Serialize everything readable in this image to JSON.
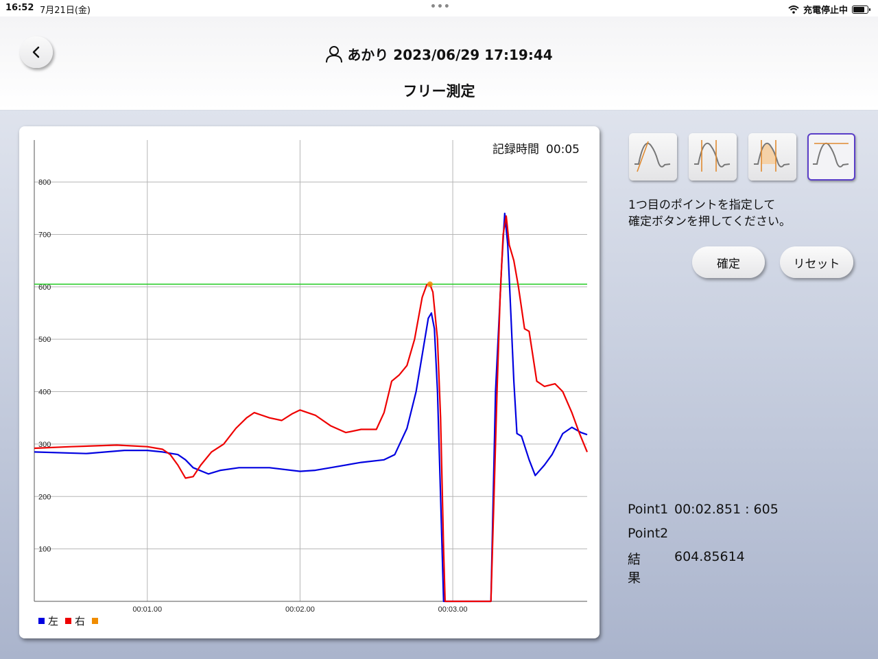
{
  "status_bar": {
    "time": "16:52",
    "date": "7月21日(金)",
    "charging": "充電停止中"
  },
  "header": {
    "user_name": "あかり",
    "timestamp": "2023/06/29 17:19:44",
    "title": "フリー測定"
  },
  "chart_panel": {
    "record_label": "記録時間",
    "record_time": "00:05"
  },
  "mode_buttons": [
    {
      "icon": "rising-slope-wave-icon",
      "selected": false
    },
    {
      "icon": "interval-wave-icon",
      "selected": false
    },
    {
      "icon": "area-wave-icon",
      "selected": false
    },
    {
      "icon": "peak-threshold-wave-icon",
      "selected": true
    }
  ],
  "instruction": {
    "line1": "1つ目のポイントを指定して",
    "line2": "確定ボタンを押してください。"
  },
  "buttons": {
    "confirm": "確定",
    "reset": "リセット"
  },
  "results": {
    "point1_label": "Point1",
    "point1_value": "00:02.851 : 605",
    "point2_label": "Point2",
    "point2_value": "",
    "result_label": "結果",
    "result_value": "604.85614"
  },
  "colors": {
    "left": "#0000e0",
    "right": "#ee0000",
    "marker": "#f08c00",
    "threshold": "#22cc22",
    "selected_border": "#5a3ec8"
  },
  "chart_data": {
    "type": "line",
    "x_tick_labels": [
      "00:01.00",
      "00:02.00",
      "00:03.00"
    ],
    "x_ticks": [
      1.0,
      2.0,
      3.0
    ],
    "xlim": [
      0.26,
      3.88
    ],
    "y_tick_labels": [
      "100",
      "200",
      "300",
      "400",
      "500",
      "600",
      "700",
      "800"
    ],
    "ylim": [
      0,
      880
    ],
    "threshold": 605,
    "marker": {
      "x": 2.851,
      "y": 605
    },
    "legend": [
      {
        "label": "左",
        "color": "#0000e0"
      },
      {
        "label": "右",
        "color": "#ee0000"
      },
      {
        "label": "",
        "color": "#f08c00"
      }
    ],
    "series": [
      {
        "name": "左",
        "color": "#0000e0",
        "points": [
          [
            0.26,
            285
          ],
          [
            0.6,
            282
          ],
          [
            0.85,
            288
          ],
          [
            1.0,
            288
          ],
          [
            1.1,
            285
          ],
          [
            1.2,
            280
          ],
          [
            1.25,
            270
          ],
          [
            1.3,
            255
          ],
          [
            1.4,
            243
          ],
          [
            1.48,
            250
          ],
          [
            1.6,
            255
          ],
          [
            1.8,
            255
          ],
          [
            2.0,
            248
          ],
          [
            2.1,
            250
          ],
          [
            2.2,
            255
          ],
          [
            2.4,
            265
          ],
          [
            2.55,
            270
          ],
          [
            2.62,
            280
          ],
          [
            2.7,
            330
          ],
          [
            2.76,
            400
          ],
          [
            2.8,
            470
          ],
          [
            2.84,
            540
          ],
          [
            2.86,
            550
          ],
          [
            2.88,
            520
          ],
          [
            2.9,
            400
          ],
          [
            2.92,
            200
          ],
          [
            2.94,
            0
          ],
          [
            3.0,
            0
          ],
          [
            3.1,
            0
          ],
          [
            3.2,
            0
          ],
          [
            3.25,
            0
          ],
          [
            3.28,
            400
          ],
          [
            3.3,
            520
          ],
          [
            3.32,
            640
          ],
          [
            3.34,
            740
          ],
          [
            3.36,
            680
          ],
          [
            3.38,
            550
          ],
          [
            3.4,
            420
          ],
          [
            3.42,
            320
          ],
          [
            3.45,
            315
          ],
          [
            3.5,
            270
          ],
          [
            3.54,
            240
          ],
          [
            3.6,
            260
          ],
          [
            3.65,
            280
          ],
          [
            3.72,
            320
          ],
          [
            3.78,
            332
          ],
          [
            3.84,
            322
          ],
          [
            3.88,
            318
          ]
        ]
      },
      {
        "name": "右",
        "color": "#ee0000",
        "points": [
          [
            0.26,
            292
          ],
          [
            0.5,
            295
          ],
          [
            0.8,
            298
          ],
          [
            1.0,
            295
          ],
          [
            1.1,
            290
          ],
          [
            1.15,
            280
          ],
          [
            1.2,
            260
          ],
          [
            1.25,
            235
          ],
          [
            1.3,
            238
          ],
          [
            1.35,
            260
          ],
          [
            1.42,
            285
          ],
          [
            1.5,
            300
          ],
          [
            1.58,
            330
          ],
          [
            1.65,
            350
          ],
          [
            1.7,
            360
          ],
          [
            1.8,
            350
          ],
          [
            1.88,
            345
          ],
          [
            1.95,
            358
          ],
          [
            2.0,
            365
          ],
          [
            2.1,
            355
          ],
          [
            2.2,
            335
          ],
          [
            2.3,
            322
          ],
          [
            2.4,
            328
          ],
          [
            2.5,
            328
          ],
          [
            2.55,
            360
          ],
          [
            2.6,
            420
          ],
          [
            2.65,
            432
          ],
          [
            2.7,
            450
          ],
          [
            2.75,
            500
          ],
          [
            2.8,
            580
          ],
          [
            2.83,
            604
          ],
          [
            2.85,
            605
          ],
          [
            2.87,
            590
          ],
          [
            2.9,
            500
          ],
          [
            2.92,
            350
          ],
          [
            2.94,
            100
          ],
          [
            2.95,
            0
          ],
          [
            3.0,
            0
          ],
          [
            3.1,
            0
          ],
          [
            3.2,
            0
          ],
          [
            3.25,
            0
          ],
          [
            3.27,
            200
          ],
          [
            3.29,
            400
          ],
          [
            3.31,
            580
          ],
          [
            3.33,
            700
          ],
          [
            3.35,
            735
          ],
          [
            3.37,
            680
          ],
          [
            3.4,
            650
          ],
          [
            3.43,
            600
          ],
          [
            3.47,
            520
          ],
          [
            3.5,
            515
          ],
          [
            3.55,
            420
          ],
          [
            3.6,
            410
          ],
          [
            3.67,
            415
          ],
          [
            3.72,
            400
          ],
          [
            3.78,
            360
          ],
          [
            3.83,
            320
          ],
          [
            3.88,
            285
          ]
        ]
      }
    ]
  }
}
